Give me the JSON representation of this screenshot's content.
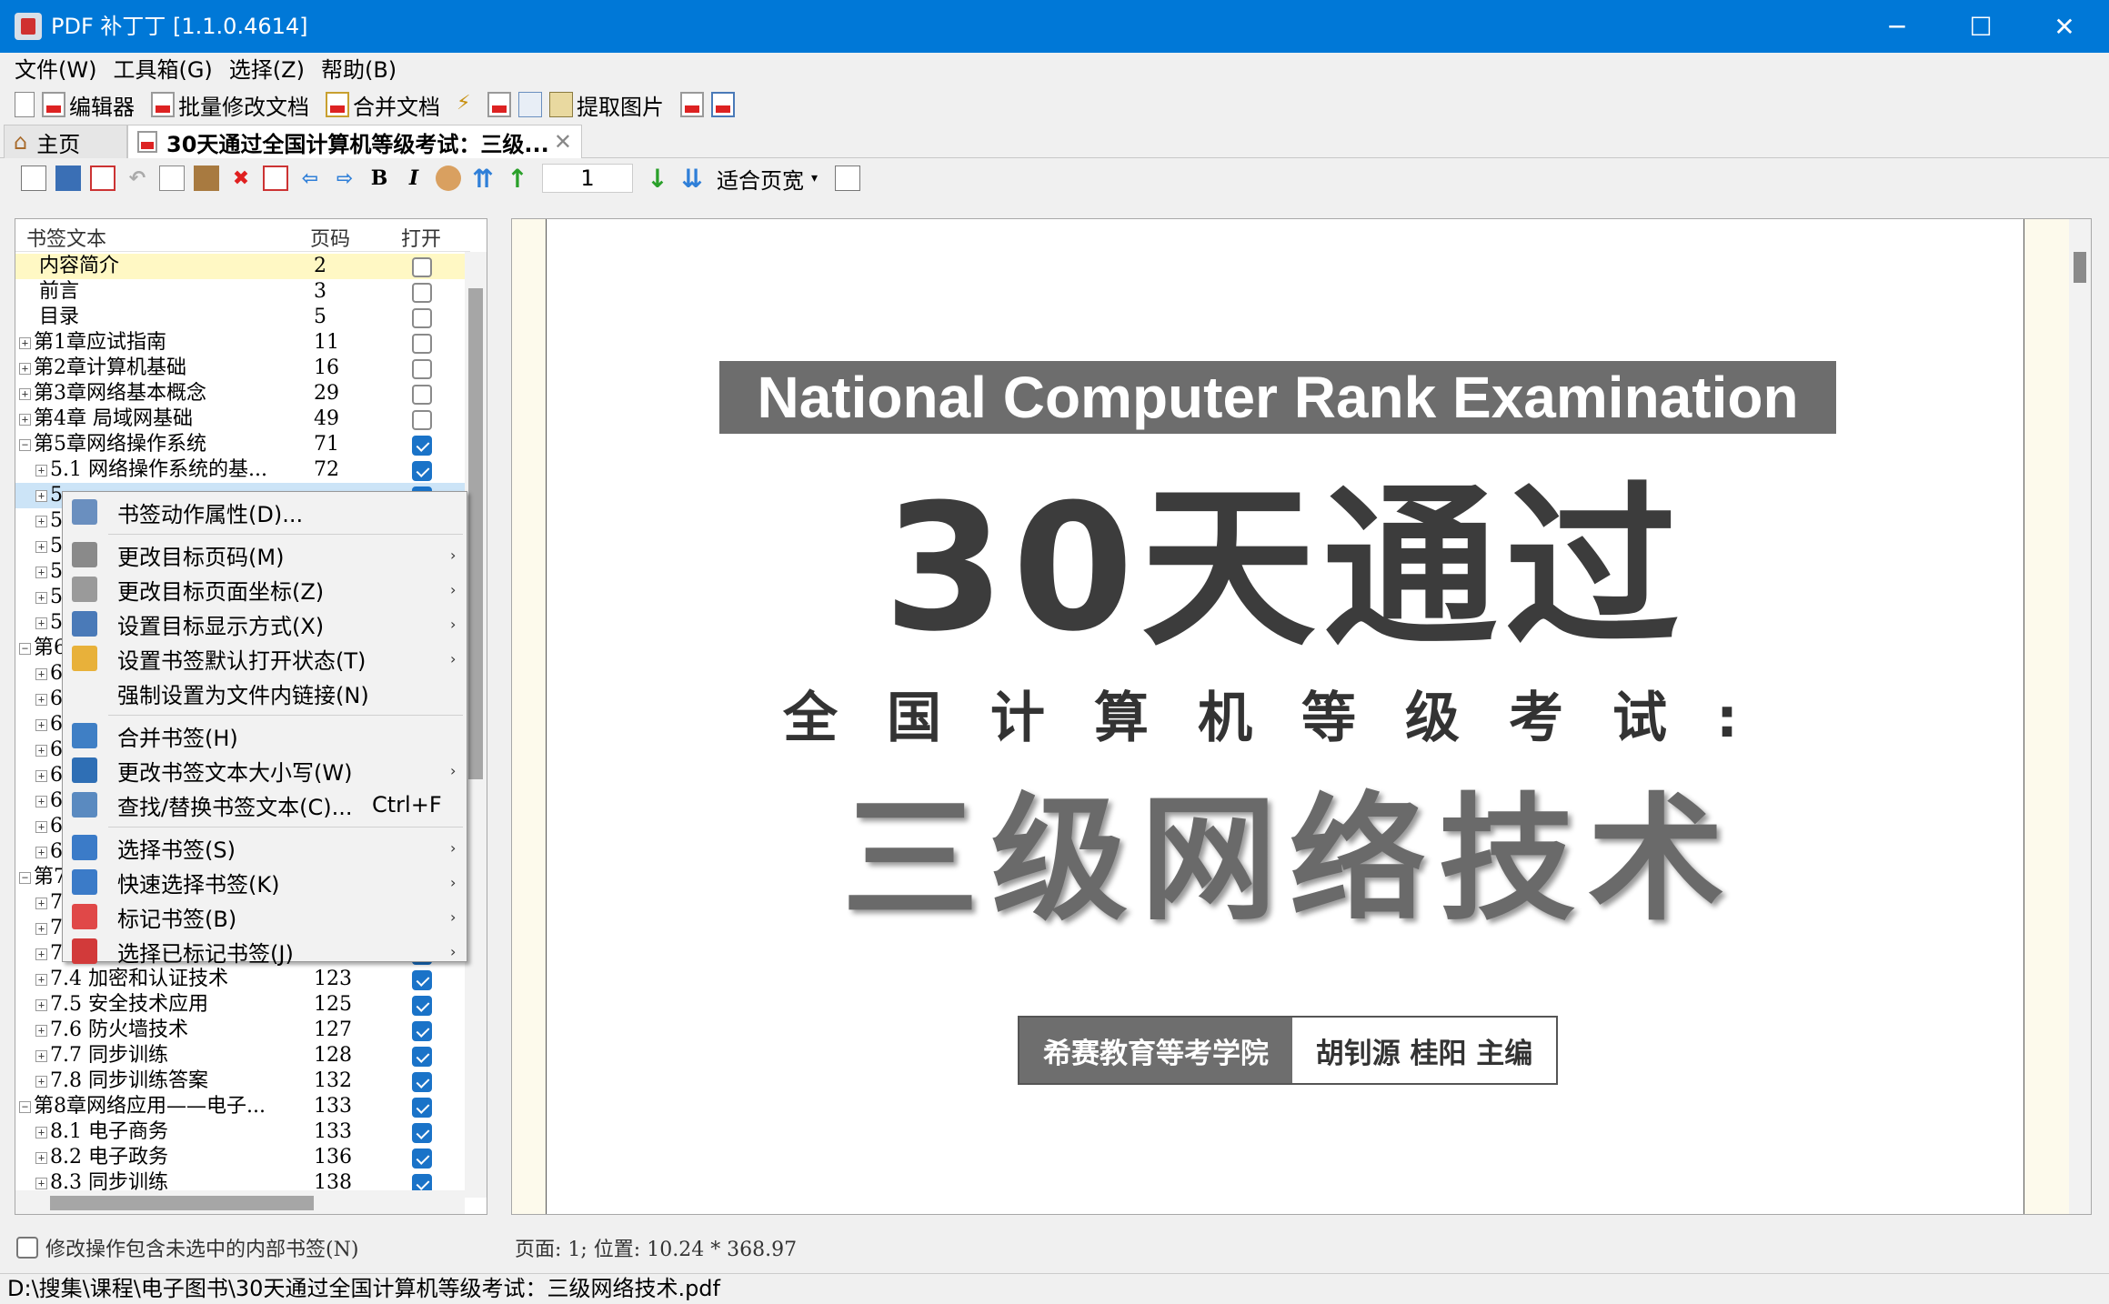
{
  "window": {
    "title": "PDF 补丁丁 [1.1.0.4614]",
    "minimize": "─",
    "maximize": "☐",
    "close": "✕"
  },
  "menu": [
    "文件(W)",
    "工具箱(G)",
    "选择(Z)",
    "帮助(B)"
  ],
  "toolbar1": {
    "editor": "编辑器",
    "batch": "批量修改文档",
    "merge": "合并文档",
    "extract_images": "提取图片"
  },
  "tabs": {
    "home": "主页",
    "doc": "30天通过全国计算机等级考试：三级...",
    "close": "✕"
  },
  "toolbar2": {
    "page_number": "1",
    "zoom": "适合页宽",
    "bold": "B",
    "italic": "I"
  },
  "bookmarks": {
    "headers": {
      "text": "书签文本",
      "page": "页码",
      "open": "打开"
    },
    "rows": [
      {
        "text": "内容简介",
        "page": "2",
        "open": false,
        "exp": "",
        "highlight": true
      },
      {
        "text": "前言",
        "page": "3",
        "open": false,
        "exp": ""
      },
      {
        "text": "目录",
        "page": "5",
        "open": false,
        "exp": ""
      },
      {
        "text": "第1章应试指南",
        "page": "11",
        "open": false,
        "exp": "+"
      },
      {
        "text": "第2章计算机基础",
        "page": "16",
        "open": false,
        "exp": "+"
      },
      {
        "text": "第3章网络基本概念",
        "page": "29",
        "open": false,
        "exp": "+"
      },
      {
        "text": "第4章 局域网基础",
        "page": "49",
        "open": false,
        "exp": "+"
      },
      {
        "text": "第5章网络操作系统",
        "page": "71",
        "open": true,
        "exp": "−"
      },
      {
        "text": "5.1 网络操作系统的基...",
        "page": "72",
        "open": true,
        "exp": "+",
        "child": true
      },
      {
        "text": "5.",
        "page": "",
        "open": true,
        "exp": "+",
        "child": true,
        "selected": true
      },
      {
        "text": "5.",
        "page": "",
        "open": true,
        "exp": "+",
        "child": true
      },
      {
        "text": "5.",
        "page": "",
        "open": true,
        "exp": "+",
        "child": true
      },
      {
        "text": "5.",
        "page": "",
        "open": true,
        "exp": "+",
        "child": true
      },
      {
        "text": "5.",
        "page": "",
        "open": true,
        "exp": "+",
        "child": true
      },
      {
        "text": "5.",
        "page": "",
        "open": true,
        "exp": "+",
        "child": true
      },
      {
        "text": "第6",
        "page": "",
        "open": true,
        "exp": "−"
      },
      {
        "text": "6.",
        "page": "",
        "open": true,
        "exp": "+",
        "child": true
      },
      {
        "text": "6.",
        "page": "",
        "open": true,
        "exp": "+",
        "child": true
      },
      {
        "text": "6.",
        "page": "",
        "open": true,
        "exp": "+",
        "child": true
      },
      {
        "text": "6.",
        "page": "",
        "open": true,
        "exp": "+",
        "child": true
      },
      {
        "text": "6.",
        "page": "",
        "open": true,
        "exp": "+",
        "child": true
      },
      {
        "text": "6.",
        "page": "",
        "open": true,
        "exp": "+",
        "child": true
      },
      {
        "text": "6.",
        "page": "",
        "open": true,
        "exp": "+",
        "child": true
      },
      {
        "text": "6.",
        "page": "",
        "open": true,
        "exp": "+",
        "child": true
      },
      {
        "text": "第7",
        "page": "",
        "open": true,
        "exp": "−"
      },
      {
        "text": "7.",
        "page": "",
        "open": true,
        "exp": "+",
        "child": true
      },
      {
        "text": "7.",
        "page": "",
        "open": true,
        "exp": "+",
        "child": true
      },
      {
        "text": "7.",
        "page": "",
        "open": true,
        "exp": "+",
        "child": true
      },
      {
        "text": "7.4 加密和认证技术",
        "page": "123",
        "open": true,
        "exp": "+",
        "child": true
      },
      {
        "text": "7.5 安全技术应用",
        "page": "125",
        "open": true,
        "exp": "+",
        "child": true
      },
      {
        "text": "7.6 防火墙技术",
        "page": "127",
        "open": true,
        "exp": "+",
        "child": true
      },
      {
        "text": "7.7 同步训练",
        "page": "128",
        "open": true,
        "exp": "+",
        "child": true
      },
      {
        "text": "7.8 同步训练答案",
        "page": "132",
        "open": true,
        "exp": "+",
        "child": true
      },
      {
        "text": "第8章网络应用——电子...",
        "page": "133",
        "open": true,
        "exp": "−"
      },
      {
        "text": "8.1 电子商务",
        "page": "133",
        "open": true,
        "exp": "+",
        "child": true
      },
      {
        "text": "8.2 电子政务",
        "page": "136",
        "open": true,
        "exp": "+",
        "child": true
      },
      {
        "text": "8.3 同步训练",
        "page": "138",
        "open": true,
        "exp": "+",
        "child": true
      }
    ],
    "checkbox_label": "修改操作包含未选中的内部书签(N)"
  },
  "context_menu": [
    {
      "label": "书签动作属性(D)...",
      "icon": "properties-icon",
      "color": "#6a8fbf"
    },
    {
      "sep": true
    },
    {
      "label": "更改目标页码(M)",
      "icon": "page-number-icon",
      "arrow": "›",
      "color": "#8a8a8a"
    },
    {
      "label": "更改目标页面坐标(Z)",
      "icon": "coordinates-icon",
      "arrow": "›",
      "color": "#9a9a9a"
    },
    {
      "label": "设置目标显示方式(X)",
      "icon": "magnifier-icon",
      "arrow": "›",
      "color": "#4a7ab8"
    },
    {
      "label": "设置书签默认打开状态(T)",
      "icon": "folder-icon",
      "arrow": "›",
      "color": "#e8b13a"
    },
    {
      "label": "强制设置为文件内链接(N)",
      "icon": "",
      "color": ""
    },
    {
      "sep": true
    },
    {
      "label": "合并书签(H)",
      "icon": "merge-icon",
      "color": "#3f7fc5"
    },
    {
      "label": "更改书签文本大小写(W)",
      "icon": "text-case-icon",
      "arrow": "›",
      "color": "#2f6fb5"
    },
    {
      "label": "查找/替换书签文本(C)...",
      "icon": "find-replace-icon",
      "shortcut": "Ctrl+F",
      "color": "#5a8ac0"
    },
    {
      "sep": true
    },
    {
      "label": "选择书签(S)",
      "icon": "select-icon",
      "arrow": "›",
      "color": "#3b7bc8"
    },
    {
      "label": "快速选择书签(K)",
      "icon": "quick-select-icon",
      "arrow": "›",
      "color": "#3b7bc8"
    },
    {
      "label": "标记书签(B)",
      "icon": "marker-icon",
      "arrow": "›",
      "color": "#e04848"
    },
    {
      "label": "选择已标记书签(J)",
      "icon": "marked-select-icon",
      "arrow": "›",
      "color": "#d23a3a"
    }
  ],
  "pdf_page": {
    "english_title": "National Computer Rank Examination",
    "big_title": "30天通过",
    "subtitle": "全国计算机等级考试:",
    "main_title": "三级网络技术",
    "publisher": "希赛教育等考学院",
    "authors": "胡钊源 桂阳 主编"
  },
  "position_info": "页面: 1; 位置: 10.24 * 368.97",
  "statusbar": "D:\\搜集\\课程\\电子图书\\30天通过全国计算机等级考试：三级网络技术.pdf"
}
